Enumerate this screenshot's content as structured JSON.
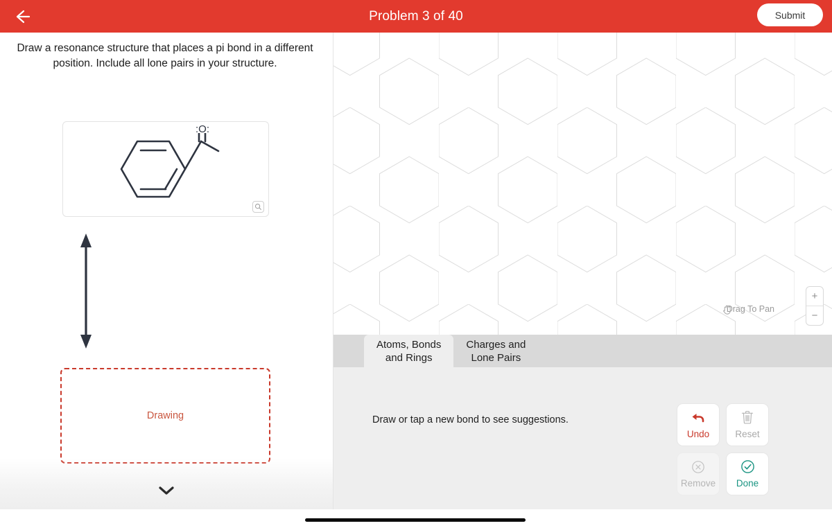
{
  "header": {
    "title": "Problem 3 of 40",
    "back_icon": "arrow-left-icon",
    "submit_label": "Submit",
    "accent_color": "#e23a2e"
  },
  "left_panel": {
    "prompt": "Draw a resonance structure that places a pi bond in a different position. Include all lone pairs in your structure.",
    "structure": {
      "name": "acetophenone",
      "oxygen_label": ":O:",
      "zoom_icon": "magnifier-icon"
    },
    "resonance_arrow_icon": "double-headed-arrow-icon",
    "drawing_zone_label": "Drawing",
    "drawing_zone_color": "#c9392b",
    "collapse_icon": "chevron-down-icon"
  },
  "right_panel": {
    "canvas": {
      "grid": "hexagonal",
      "pan_hint": "Drag To Pan",
      "pan_icon": "hand-icon",
      "zoom_in_label": "+",
      "zoom_out_label": "−"
    },
    "tabs": [
      {
        "label_line1": "Atoms, Bonds",
        "label_line2": "and Rings",
        "active": true
      },
      {
        "label_line1": "Charges and",
        "label_line2": "Lone Pairs",
        "active": false
      }
    ],
    "hint": "Draw or tap a new bond to see suggestions.",
    "buttons": [
      {
        "label": "Undo",
        "icon": "undo-arrow-icon",
        "enabled": true,
        "color": "#c9392b"
      },
      {
        "label": "Reset",
        "icon": "trash-icon",
        "enabled": false,
        "color": "#a9a9a9"
      },
      {
        "label": "Remove",
        "icon": "circle-x-icon",
        "enabled": false,
        "color": "#b5b5b5"
      },
      {
        "label": "Done",
        "icon": "circle-check-icon",
        "enabled": true,
        "color": "#1a9482"
      }
    ]
  },
  "system": {
    "home_indicator": true
  }
}
